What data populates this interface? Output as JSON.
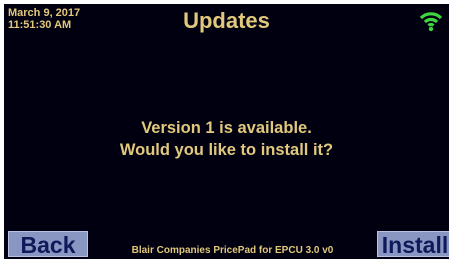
{
  "status": {
    "date": "March 9, 2017",
    "time": "11:51:30 AM",
    "wifi_icon": "wifi-icon"
  },
  "header": {
    "title": "Updates"
  },
  "message": {
    "line1": "Version 1 is available.",
    "line2": "Would you like to install it?"
  },
  "buttons": {
    "back_label": "Back",
    "install_label": "Install"
  },
  "footer": {
    "text": "Blair Companies PricePad for EPCU 3.0 v0"
  },
  "colors": {
    "background": "#000010",
    "text": "#e2c87d",
    "button": "#8a96c2",
    "wifi": "#3fd63f"
  }
}
